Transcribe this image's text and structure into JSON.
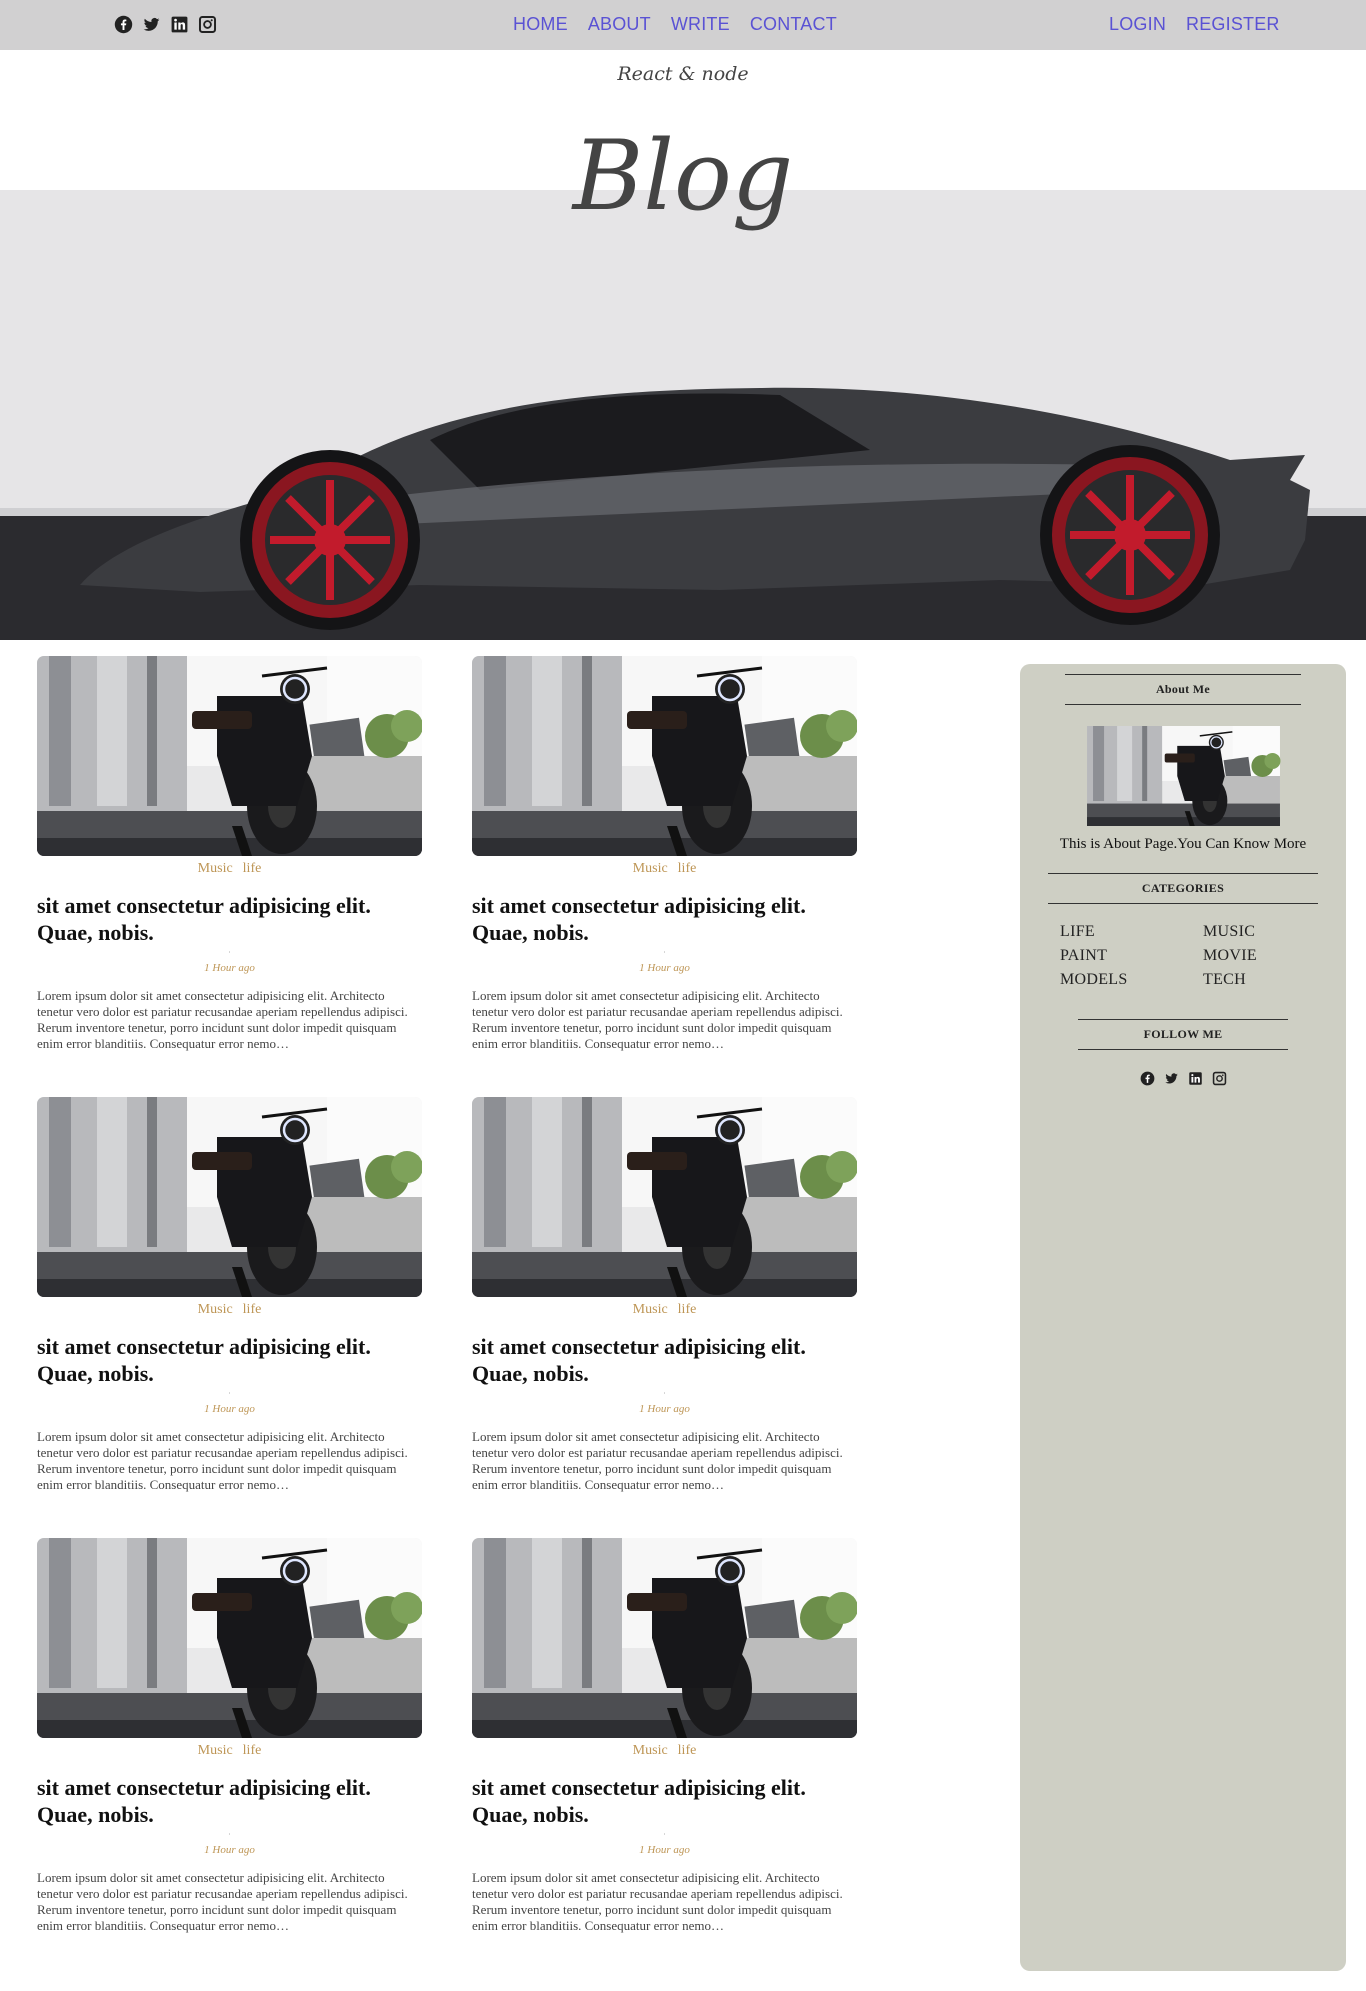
{
  "colors": {
    "topbar_bg": "#d1d0d1",
    "nav_link": "#5a52d4",
    "category_accent": "#be9656",
    "sidebar_bg": "#cecfc4"
  },
  "topbar": {
    "social_icons": [
      "facebook-icon",
      "twitter-icon",
      "linkedin-icon",
      "instagram-icon"
    ],
    "menu": [
      "HOME",
      "ABOUT",
      "WRITE",
      "CONTACT"
    ],
    "auth": [
      "LOGIN",
      "REGISTER"
    ]
  },
  "header": {
    "subtitle": "React & node",
    "title": "Blog"
  },
  "posts": [
    {
      "cats": [
        "Music",
        "life"
      ],
      "title": "sit amet consectetur adipisicing elit. Quae, nobis.",
      "date": "1 Hour ago",
      "desc": "Lorem ipsum dolor sit amet consectetur adipisicing elit. Architecto tenetur vero dolor est pariatur recusandae aperiam repellendus adipisci. Rerum inventore tenetur, porro incidunt sunt dolor impedit quisquam enim error blanditiis. Consequatur error nemo…"
    },
    {
      "cats": [
        "Music",
        "life"
      ],
      "title": "sit amet consectetur adipisicing elit. Quae, nobis.",
      "date": "1 Hour ago",
      "desc": "Lorem ipsum dolor sit amet consectetur adipisicing elit. Architecto tenetur vero dolor est pariatur recusandae aperiam repellendus adipisci. Rerum inventore tenetur, porro incidunt sunt dolor impedit quisquam enim error blanditiis. Consequatur error nemo…"
    },
    {
      "cats": [
        "Music",
        "life"
      ],
      "title": "sit amet consectetur adipisicing elit. Quae, nobis.",
      "date": "1 Hour ago",
      "desc": "Lorem ipsum dolor sit amet consectetur adipisicing elit. Architecto tenetur vero dolor est pariatur recusandae aperiam repellendus adipisci. Rerum inventore tenetur, porro incidunt sunt dolor impedit quisquam enim error blanditiis. Consequatur error nemo…"
    },
    {
      "cats": [
        "Music",
        "life"
      ],
      "title": "sit amet consectetur adipisicing elit. Quae, nobis.",
      "date": "1 Hour ago",
      "desc": "Lorem ipsum dolor sit amet consectetur adipisicing elit. Architecto tenetur vero dolor est pariatur recusandae aperiam repellendus adipisci. Rerum inventore tenetur, porro incidunt sunt dolor impedit quisquam enim error blanditiis. Consequatur error nemo…"
    },
    {
      "cats": [
        "Music",
        "life"
      ],
      "title": "sit amet consectetur adipisicing elit. Quae, nobis.",
      "date": "1 Hour ago",
      "desc": "Lorem ipsum dolor sit amet consectetur adipisicing elit. Architecto tenetur vero dolor est pariatur recusandae aperiam repellendus adipisci. Rerum inventore tenetur, porro incidunt sunt dolor impedit quisquam enim error blanditiis. Consequatur error nemo…"
    },
    {
      "cats": [
        "Music",
        "life"
      ],
      "title": "sit amet consectetur adipisicing elit. Quae, nobis.",
      "date": "1 Hour ago",
      "desc": "Lorem ipsum dolor sit amet consectetur adipisicing elit. Architecto tenetur vero dolor est pariatur recusandae aperiam repellendus adipisci. Rerum inventore tenetur, porro incidunt sunt dolor impedit quisquam enim error blanditiis. Consequatur error nemo…"
    }
  ],
  "sidebar": {
    "about_title": "About Me",
    "about_text": "This is About Page.You Can Know More",
    "categories_title": "CATEGORIES",
    "categories": [
      "LIFE",
      "MUSIC",
      "PAINT",
      "MOVIE",
      "MODELS",
      "TECH"
    ],
    "follow_title": "FOLLOW ME",
    "social_icons": [
      "facebook-icon",
      "twitter-icon",
      "linkedin-icon",
      "instagram-icon"
    ]
  }
}
